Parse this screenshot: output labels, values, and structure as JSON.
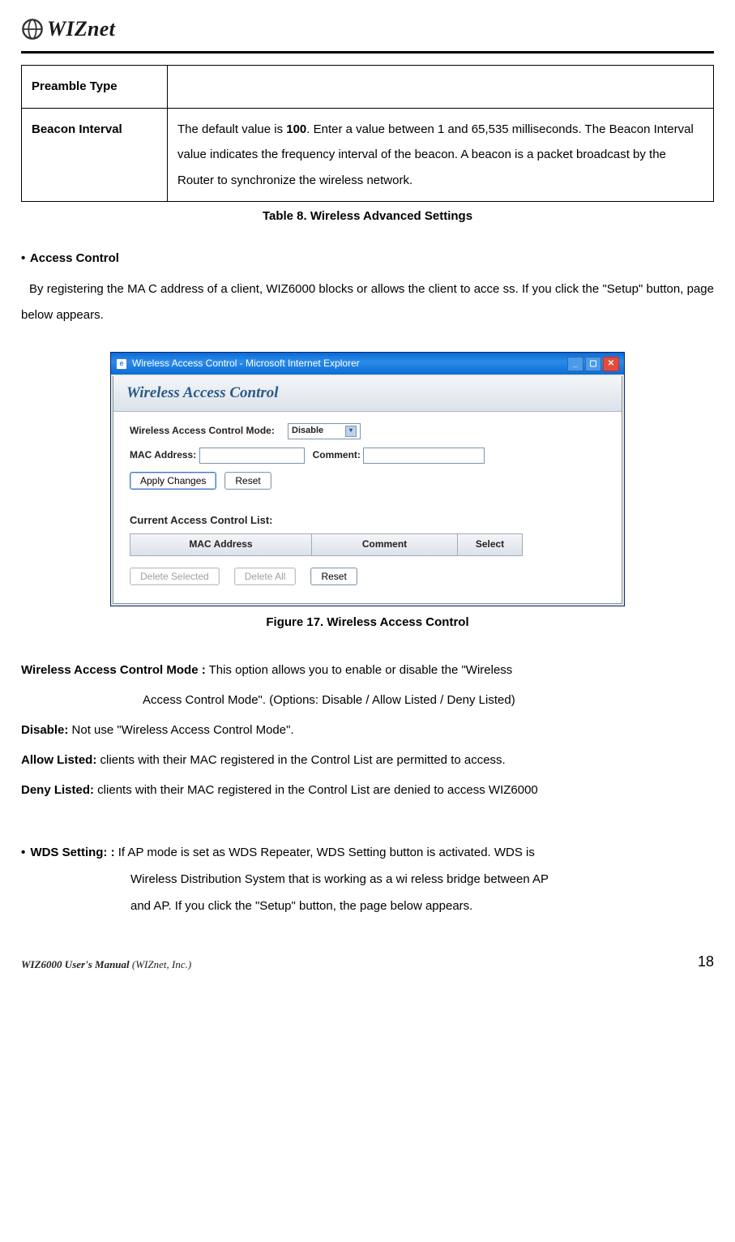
{
  "logo": {
    "text": "WIZnet"
  },
  "table": {
    "rows": [
      {
        "label": "Preamble Type",
        "value": ""
      },
      {
        "label": "Beacon Interval",
        "value": "The default value is ",
        "bold": "100",
        "value_after": ". Enter a value between 1 and 65,535 milliseconds. The Beacon Interval value indicates the frequency interval of the beacon. A beacon is a packet broadcast by the Router to synchronize the wireless network."
      }
    ],
    "caption": "Table 8. Wireless Advanced Settings"
  },
  "access_control": {
    "heading": "Access Control",
    "para": "By registering the MA C address of a client, WIZ6000 blocks or allows the client to acce ss. If you click the \"Setup\" button, page below appears."
  },
  "ie_window": {
    "title": "Wireless Access Control - Microsoft Internet Explorer",
    "band_title": "Wireless Access Control",
    "mode_label": "Wireless Access Control Mode:",
    "mode_value": "Disable",
    "mac_label": "MAC Address:",
    "comment_label": "Comment:",
    "apply_btn": "Apply Changes",
    "reset_btn": "Reset",
    "cacl_label": "Current Access Control List:",
    "col1": "MAC Address",
    "col2": "Comment",
    "col3": "Select",
    "del_sel": "Delete Selected",
    "del_all": "Delete All",
    "reset2": "Reset"
  },
  "figure_caption": "Figure 17. Wireless Access Control",
  "definitions": {
    "wacm_label": "Wireless Access Control Mode :",
    "wacm_text": " This option allows you to enable or disable the \"Wireless",
    "wacm_line2": "Access Control Mode\". (Options: Disable / Allow Listed / Deny Listed)",
    "disable_label": "Disable:",
    "disable_text": " Not use \"Wireless Access Control Mode\".",
    "allow_label": "Allow Listed:",
    "allow_text": " clients with their MAC registered in the Control List are permitted to access.",
    "deny_label": "Deny Listed:",
    "deny_text": " clients with their MAC registered in the Control List are denied to access WIZ6000"
  },
  "wds": {
    "label": "WDS Setting: :",
    "line1": " If AP mode is set as WDS Repeater, WDS Setting button is activated. WDS is",
    "line2": "Wireless Distribution System that is working as a wi reless bridge between AP",
    "line3": "and AP. If you click the \"Setup\" button, the page below appears."
  },
  "footer": {
    "left1": "WIZ6000 User's Manual ",
    "left2": "(WIZnet, Inc.)",
    "page": "18"
  }
}
